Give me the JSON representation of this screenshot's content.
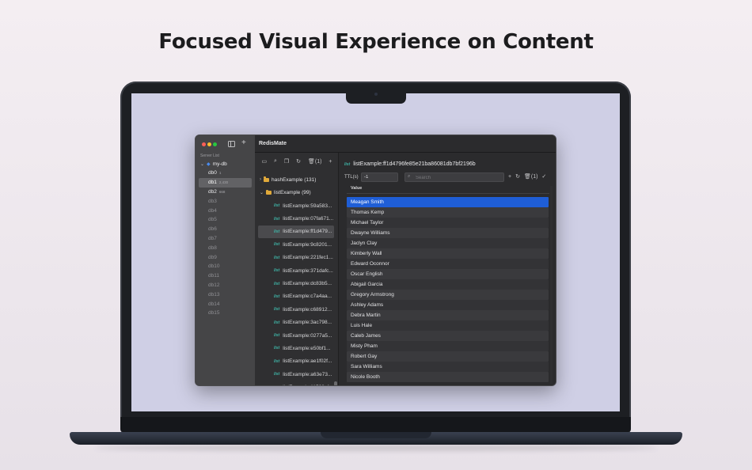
{
  "headline": "Focused Visual Experience on Content",
  "app": {
    "title": "RedisMate",
    "add_symbol": "+"
  },
  "sidebar": {
    "section_label": "Server List",
    "server_name": "my-db",
    "databases": [
      {
        "name": "db0",
        "count": "1",
        "selected": false
      },
      {
        "name": "db1",
        "count": "2,430",
        "selected": true
      },
      {
        "name": "db2",
        "count": "668",
        "selected": false
      },
      {
        "name": "db3",
        "count": "",
        "selected": false
      },
      {
        "name": "db4",
        "count": "",
        "selected": false
      },
      {
        "name": "db5",
        "count": "",
        "selected": false
      },
      {
        "name": "db6",
        "count": "",
        "selected": false
      },
      {
        "name": "db7",
        "count": "",
        "selected": false
      },
      {
        "name": "db8",
        "count": "",
        "selected": false
      },
      {
        "name": "db9",
        "count": "",
        "selected": false
      },
      {
        "name": "db10",
        "count": "",
        "selected": false
      },
      {
        "name": "db11",
        "count": "",
        "selected": false
      },
      {
        "name": "db12",
        "count": "",
        "selected": false
      },
      {
        "name": "db13",
        "count": "",
        "selected": false
      },
      {
        "name": "db14",
        "count": "",
        "selected": false
      },
      {
        "name": "db15",
        "count": "",
        "selected": false
      }
    ]
  },
  "keys_toolbar": {
    "delete_count": "(1)",
    "add_symbol": "+"
  },
  "tree": {
    "type_tag": "list",
    "folders": [
      {
        "label": "hashExample (131)",
        "expanded": false
      },
      {
        "label": "listExample (99)",
        "expanded": true
      }
    ],
    "keys": [
      {
        "label": "listExample:59a583...",
        "selected": false
      },
      {
        "label": "listExample:07fa671...",
        "selected": false
      },
      {
        "label": "listExample:ff1d479...",
        "selected": true
      },
      {
        "label": "listExample:9c8201...",
        "selected": false
      },
      {
        "label": "listExample:221fec1...",
        "selected": false
      },
      {
        "label": "listExample:371dafc...",
        "selected": false
      },
      {
        "label": "listExample:dc83b5...",
        "selected": false
      },
      {
        "label": "listExample:c7a4aa...",
        "selected": false
      },
      {
        "label": "listExample:c68912...",
        "selected": false
      },
      {
        "label": "listExample:3ac798...",
        "selected": false
      },
      {
        "label": "listExample:0277a5...",
        "selected": false
      },
      {
        "label": "listExample:e50bf1...",
        "selected": false
      },
      {
        "label": "listExample:ae1f02f...",
        "selected": false
      },
      {
        "label": "listExample:a63e73...",
        "selected": false
      },
      {
        "label": "listExample:11508ef",
        "selected": false
      }
    ]
  },
  "detail": {
    "type_tag": "list",
    "key_name": "listExample:ff1d4796fe85e21ba86081db7bf2196b",
    "ttl_label": "TTL(s)",
    "ttl_value": "-1",
    "search_placeholder": "Search",
    "delete_count": "(1)",
    "column_header": "Value",
    "values": [
      {
        "text": "Meagan Smith",
        "selected": true
      },
      {
        "text": "Thomas Kemp",
        "selected": false
      },
      {
        "text": "Michael Taylor",
        "selected": false
      },
      {
        "text": "Dwayne Williams",
        "selected": false
      },
      {
        "text": "Jaclyn Clay",
        "selected": false
      },
      {
        "text": "Kimberly Wall",
        "selected": false
      },
      {
        "text": "Edward Oconnor",
        "selected": false
      },
      {
        "text": "Oscar English",
        "selected": false
      },
      {
        "text": "Abigail Garcia",
        "selected": false
      },
      {
        "text": "Gregory Armstrong",
        "selected": false
      },
      {
        "text": "Ashley Adams",
        "selected": false
      },
      {
        "text": "Debra Martin",
        "selected": false
      },
      {
        "text": "Luis Hale",
        "selected": false
      },
      {
        "text": "Caleb James",
        "selected": false
      },
      {
        "text": "Misty Pham",
        "selected": false
      },
      {
        "text": "Robert Gay",
        "selected": false
      },
      {
        "text": "Sara Williams",
        "selected": false
      },
      {
        "text": "Nicole Booth",
        "selected": false
      }
    ]
  },
  "colors": {
    "accent_selection": "#1f5ed6",
    "type_tag": "#3fb6a8",
    "folder": "#e0a93a"
  }
}
